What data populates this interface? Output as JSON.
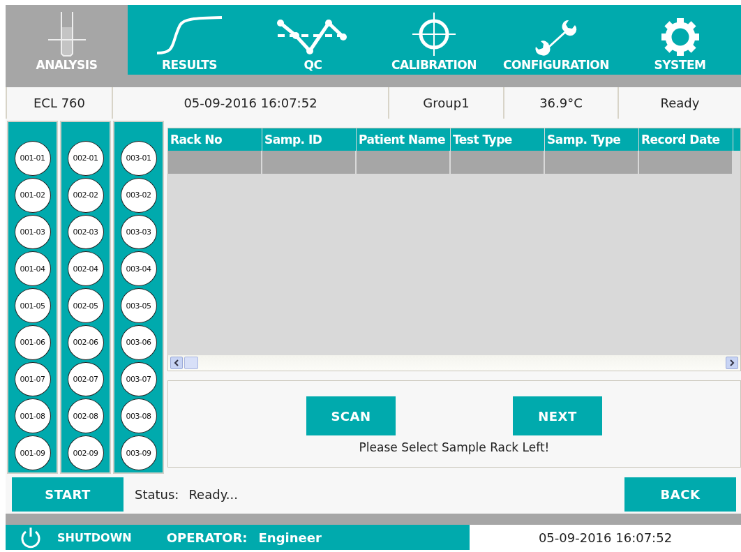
{
  "nav_tabs": [
    {
      "label": "ANALYSIS",
      "selected": true
    },
    {
      "label": "RESULTS",
      "selected": false
    },
    {
      "label": "QC",
      "selected": false
    },
    {
      "label": "CALIBRATION",
      "selected": false
    },
    {
      "label": "CONFIGURATION",
      "selected": false
    },
    {
      "label": "SYSTEM",
      "selected": false
    }
  ],
  "info_bar": [
    "ECL 760",
    "05-09-2016 16:07:52",
    "Group1",
    "36.9°C",
    "Ready"
  ],
  "racks": [
    {
      "slots": [
        "001-01",
        "001-02",
        "001-03",
        "001-04",
        "001-05",
        "001-06",
        "001-07",
        "001-08",
        "001-09"
      ]
    },
    {
      "slots": [
        "002-01",
        "002-02",
        "002-03",
        "002-04",
        "002-05",
        "002-06",
        "002-07",
        "002-08",
        "002-09"
      ]
    },
    {
      "slots": [
        "003-01",
        "003-02",
        "003-03",
        "003-04",
        "003-05",
        "003-06",
        "003-07",
        "003-08",
        "003-09"
      ]
    }
  ],
  "table": {
    "columns": [
      "Rack No",
      "Samp. ID",
      "Patient Name",
      "Test Type",
      "Samp. Type",
      "Record Date"
    ]
  },
  "actions": {
    "buttons": [
      "SCAN",
      "NEXT"
    ],
    "message": "Please Select Sample Rack Left!"
  },
  "control_row": {
    "start_button": "START",
    "status_label": "Status:",
    "status_value": "Ready...",
    "back_button": "BACK"
  },
  "footer": {
    "shutdown": "SHUTDOWN",
    "operator_label": "OPERATOR:",
    "operator": "Engineer",
    "datetime": "05-09-2016 16:07:52"
  }
}
